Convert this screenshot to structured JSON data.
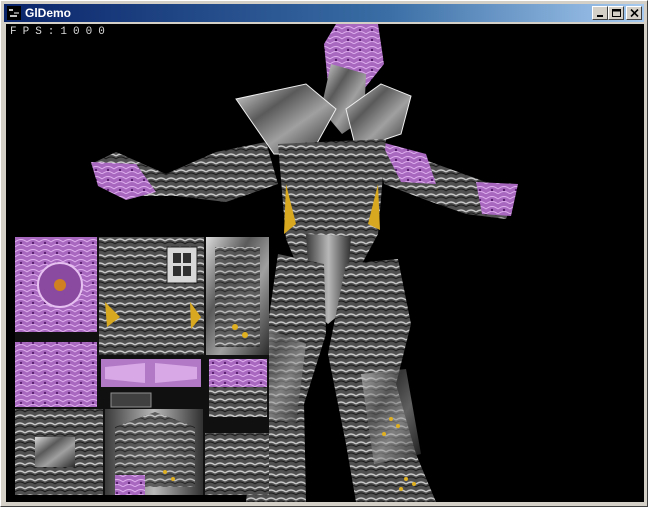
{
  "window": {
    "title": "GlDemo",
    "controls": [
      "minimize",
      "maximize",
      "close"
    ]
  },
  "overlay": {
    "fps_text": "FPS:1000"
  },
  "render": {
    "model": "alien-warrior-character",
    "texture_atlas": "skin-texture-sheet",
    "colors": {
      "background": "#000000",
      "accent_purple": "#b070c8",
      "metal_gray": "#707070",
      "highlight_yellow": "#e0b020"
    }
  },
  "icons": {
    "app": "app-icon",
    "minimize": "minimize-icon",
    "maximize": "maximize-icon",
    "close": "close-icon"
  }
}
